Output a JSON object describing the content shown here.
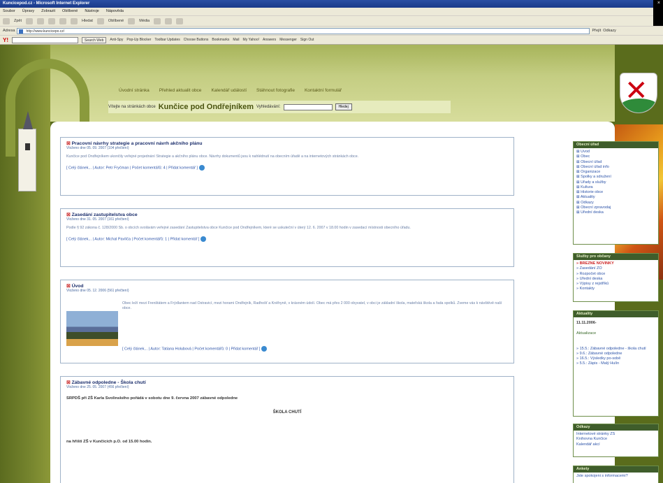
{
  "browser": {
    "title": "Kuncicepod.cz - Microsoft Internet Explorer",
    "menu": [
      "Soubor",
      "Úpravy",
      "Zobrazit",
      "Oblíbené",
      "Nástroje",
      "Nápověda"
    ],
    "toolbar": {
      "back": "Zpět",
      "search": "Hledat",
      "favorites": "Oblíbené",
      "media": "Média"
    },
    "address_label": "Adresa",
    "address_value": "http://www.kuncicepo.cz/",
    "go_label": "Přejít",
    "links_label": "Odkazy",
    "yahoo_search_btn": "Search Web",
    "yahoo_items": [
      "Anti-Spy",
      "Pop-Up Blocker",
      "Toolbar Updates",
      "Choose Buttons",
      "Bookmarks",
      "Mail",
      "My Yahoo!",
      "Answers",
      "Messenger",
      "Sign Out"
    ]
  },
  "site": {
    "nav": [
      "Úvodní stránka",
      "Přehled aktualit obce",
      "Kalendář událostí",
      "Stáhnout fotografie",
      "Kontaktní formulář"
    ],
    "welcome_prefix": "Vítejte na stránkách obce",
    "town": "Kunčice pod Ondřejníkem",
    "search_label": "Vyhledávání:",
    "search_btn": "Hledej"
  },
  "articles": [
    {
      "title": "Pracovní návrhy strategie a pracovní návrh akčního plánu",
      "meta": "Vloženo dne 05. 09. 2007 (104 přečtení)",
      "body": "Kunčice pod Ondřejníkem ukončily veřejné projednání Strategie a akčního plánu obce. Návrhy dokumentů jsou k nahlédnutí na obecním úřadě a na internetových stránkách obce.",
      "links": "[ Celý článek... | Autor: Petr Fryčman | Počet komentářů: 4 | Přidat komentář ]"
    },
    {
      "title": "Zasedání zastupitelstva obce",
      "meta": "Vloženo dne 31. 05. 2007 (161 přečtení)",
      "body": "Podle § 92 zákona č. 128/2000 Sb. o obcích svolávám veřejné zasedání Zastupitelstva obce Kunčice pod Ondřejníkem, které se uskuteční v úterý 12. 6. 2007 v 18.00 hodin v zasedací místnosti obecního úřadu.",
      "links": "[ Celý článek... | Autor: Michal Pavlíča | Počet komentářů: 1 | Přidat komentář ]"
    },
    {
      "title": "Úvod",
      "meta": "Vloženo dne 05. 12. 2006 (561 přečtení)",
      "body": "Obec leží mezi Frenštátem a Frýdlantem nad Ostravicí, mezi horami Ondřejník, Radhošť a Kněhyně, v krásném údolí. Obec má přes 2 000 obyvatel, v obci je základní škola, mateřská škola a řada spolků. Zveme vás k návštěvě naší obce.",
      "links": "[ Celý článek... | Autor: Tatiana Holubová | Počet komentářů: 0 | Přidat komentář ]"
    },
    {
      "title": "Zábavné odpoledne - Škola chutí",
      "meta": "Vloženo dne 25. 05. 2007 (456 přečtení)",
      "line1": "SRPDŠ při ZŠ Karla Svolinského pořádá v sobotu dne 9. června 2007 zábavné odpoledne",
      "line2": "ŠKOLA CHUTÍ",
      "line3": "na hřišti ZŠ v Kunčicích p.O. od 15.00 hodin."
    }
  ],
  "sidebar": {
    "box1_title": "Obecní úřad",
    "box1_items": [
      "Úvod",
      "Obec",
      "Obecní úřad",
      "Obecní úřad info",
      "Organizace",
      "Spolky a sdružení",
      "Úřady a služby",
      "Kultura",
      "Historie obce",
      "Aktuality",
      "Odkazy",
      "Obecní zpravodaj",
      "Úřední deska"
    ],
    "box2_title": "Služby pro občany",
    "box2_items": [
      "» BŘEZNÉ NOVINKY",
      "» Zasedání ZO",
      "» Rozpočet obce",
      "» Úřední deska",
      "» Výpisy z rejstříků",
      "» Kontakty"
    ],
    "box3_title": "Aktuality",
    "box3_date": "11.11.2006-",
    "box3_sub": "Aktualizace",
    "box3_items": [
      "» 15.5.: Zábavné odpoledne - škola chutí",
      "» 9.6.: Zábavné odpoledne",
      "» 16.5.: Výsledky po-sobě",
      "» 5.5.: Zápis - Malý Hulín"
    ],
    "box4_title": "Odkazy",
    "box4_items": [
      "Internetové stránky ZŠ",
      "Knihovna Kunčice",
      "Kalendář akcí"
    ],
    "box5_title": "Ankety",
    "box5_items": [
      "Jste spokojeni s informacemi?"
    ]
  }
}
